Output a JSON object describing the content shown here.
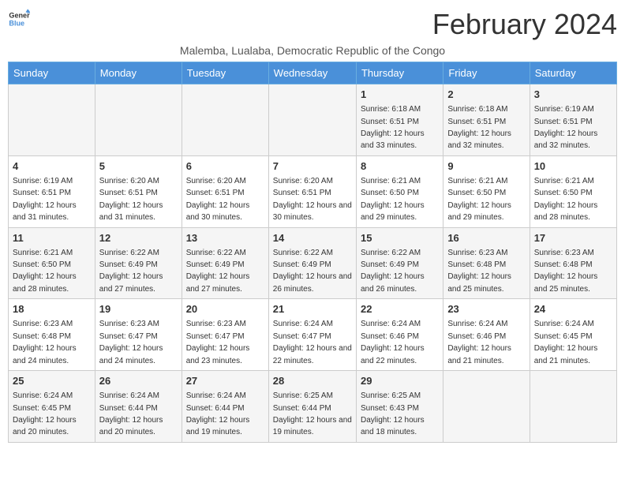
{
  "header": {
    "logo_line1": "General",
    "logo_line2": "Blue",
    "main_title": "February 2024",
    "subtitle": "Malemba, Lualaba, Democratic Republic of the Congo"
  },
  "days_of_week": [
    "Sunday",
    "Monday",
    "Tuesday",
    "Wednesday",
    "Thursday",
    "Friday",
    "Saturday"
  ],
  "weeks": [
    [
      {
        "day": "",
        "info": ""
      },
      {
        "day": "",
        "info": ""
      },
      {
        "day": "",
        "info": ""
      },
      {
        "day": "",
        "info": ""
      },
      {
        "day": "1",
        "info": "Sunrise: 6:18 AM\nSunset: 6:51 PM\nDaylight: 12 hours and 33 minutes."
      },
      {
        "day": "2",
        "info": "Sunrise: 6:18 AM\nSunset: 6:51 PM\nDaylight: 12 hours and 32 minutes."
      },
      {
        "day": "3",
        "info": "Sunrise: 6:19 AM\nSunset: 6:51 PM\nDaylight: 12 hours and 32 minutes."
      }
    ],
    [
      {
        "day": "4",
        "info": "Sunrise: 6:19 AM\nSunset: 6:51 PM\nDaylight: 12 hours and 31 minutes."
      },
      {
        "day": "5",
        "info": "Sunrise: 6:20 AM\nSunset: 6:51 PM\nDaylight: 12 hours and 31 minutes."
      },
      {
        "day": "6",
        "info": "Sunrise: 6:20 AM\nSunset: 6:51 PM\nDaylight: 12 hours and 30 minutes."
      },
      {
        "day": "7",
        "info": "Sunrise: 6:20 AM\nSunset: 6:51 PM\nDaylight: 12 hours and 30 minutes."
      },
      {
        "day": "8",
        "info": "Sunrise: 6:21 AM\nSunset: 6:50 PM\nDaylight: 12 hours and 29 minutes."
      },
      {
        "day": "9",
        "info": "Sunrise: 6:21 AM\nSunset: 6:50 PM\nDaylight: 12 hours and 29 minutes."
      },
      {
        "day": "10",
        "info": "Sunrise: 6:21 AM\nSunset: 6:50 PM\nDaylight: 12 hours and 28 minutes."
      }
    ],
    [
      {
        "day": "11",
        "info": "Sunrise: 6:21 AM\nSunset: 6:50 PM\nDaylight: 12 hours and 28 minutes."
      },
      {
        "day": "12",
        "info": "Sunrise: 6:22 AM\nSunset: 6:49 PM\nDaylight: 12 hours and 27 minutes."
      },
      {
        "day": "13",
        "info": "Sunrise: 6:22 AM\nSunset: 6:49 PM\nDaylight: 12 hours and 27 minutes."
      },
      {
        "day": "14",
        "info": "Sunrise: 6:22 AM\nSunset: 6:49 PM\nDaylight: 12 hours and 26 minutes."
      },
      {
        "day": "15",
        "info": "Sunrise: 6:22 AM\nSunset: 6:49 PM\nDaylight: 12 hours and 26 minutes."
      },
      {
        "day": "16",
        "info": "Sunrise: 6:23 AM\nSunset: 6:48 PM\nDaylight: 12 hours and 25 minutes."
      },
      {
        "day": "17",
        "info": "Sunrise: 6:23 AM\nSunset: 6:48 PM\nDaylight: 12 hours and 25 minutes."
      }
    ],
    [
      {
        "day": "18",
        "info": "Sunrise: 6:23 AM\nSunset: 6:48 PM\nDaylight: 12 hours and 24 minutes."
      },
      {
        "day": "19",
        "info": "Sunrise: 6:23 AM\nSunset: 6:47 PM\nDaylight: 12 hours and 24 minutes."
      },
      {
        "day": "20",
        "info": "Sunrise: 6:23 AM\nSunset: 6:47 PM\nDaylight: 12 hours and 23 minutes."
      },
      {
        "day": "21",
        "info": "Sunrise: 6:24 AM\nSunset: 6:47 PM\nDaylight: 12 hours and 22 minutes."
      },
      {
        "day": "22",
        "info": "Sunrise: 6:24 AM\nSunset: 6:46 PM\nDaylight: 12 hours and 22 minutes."
      },
      {
        "day": "23",
        "info": "Sunrise: 6:24 AM\nSunset: 6:46 PM\nDaylight: 12 hours and 21 minutes."
      },
      {
        "day": "24",
        "info": "Sunrise: 6:24 AM\nSunset: 6:45 PM\nDaylight: 12 hours and 21 minutes."
      }
    ],
    [
      {
        "day": "25",
        "info": "Sunrise: 6:24 AM\nSunset: 6:45 PM\nDaylight: 12 hours and 20 minutes."
      },
      {
        "day": "26",
        "info": "Sunrise: 6:24 AM\nSunset: 6:44 PM\nDaylight: 12 hours and 20 minutes."
      },
      {
        "day": "27",
        "info": "Sunrise: 6:24 AM\nSunset: 6:44 PM\nDaylight: 12 hours and 19 minutes."
      },
      {
        "day": "28",
        "info": "Sunrise: 6:25 AM\nSunset: 6:44 PM\nDaylight: 12 hours and 19 minutes."
      },
      {
        "day": "29",
        "info": "Sunrise: 6:25 AM\nSunset: 6:43 PM\nDaylight: 12 hours and 18 minutes."
      },
      {
        "day": "",
        "info": ""
      },
      {
        "day": "",
        "info": ""
      }
    ]
  ]
}
